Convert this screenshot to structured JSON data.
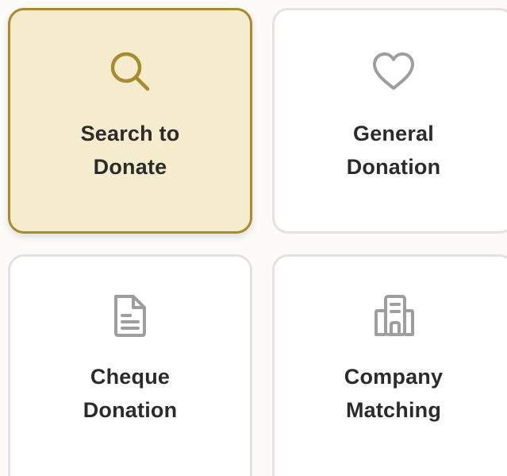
{
  "options": [
    {
      "icon": "search-icon",
      "label_line1": "Search to",
      "label_line2": "Donate",
      "selected": true
    },
    {
      "icon": "heart-icon",
      "label_line1": "General",
      "label_line2": "Donation",
      "selected": false
    },
    {
      "icon": "document-icon",
      "label_line1": "Cheque",
      "label_line2": "Donation",
      "selected": false
    },
    {
      "icon": "building-icon",
      "label_line1": "Company",
      "label_line2": "Matching",
      "selected": false
    }
  ],
  "colors": {
    "selected_bg": "#f5ecce",
    "selected_border": "#a98a2c",
    "icon_selected": "#a98a2c",
    "icon_default": "#9e9e9e",
    "text": "#2b2b2b"
  }
}
